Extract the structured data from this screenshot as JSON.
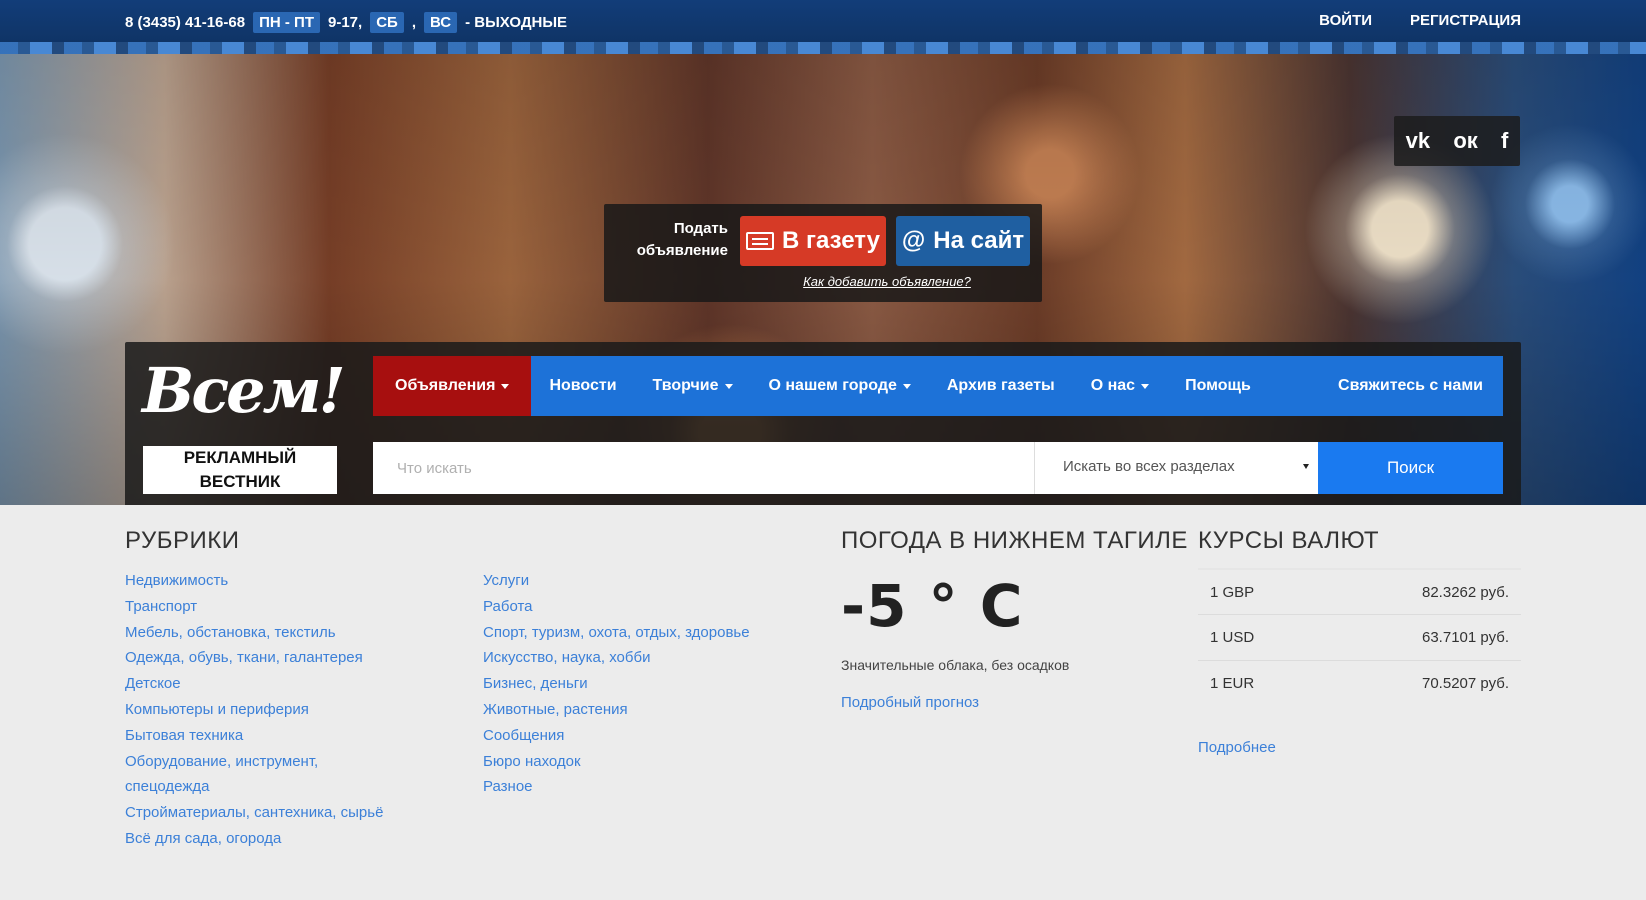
{
  "topbar": {
    "phone": "8 (3435) 41-16-68",
    "days": "ПН - ПТ",
    "hours": "9-17,",
    "sat": "СБ",
    "sun": "ВС",
    "weekend": "- ВЫХОДНЫЕ",
    "login": "ВОЙТИ",
    "register": "РЕГИСТРАЦИЯ"
  },
  "social": {
    "vk": "vk",
    "ok": "ок",
    "fb": "f"
  },
  "post": {
    "label": "Подать объявление",
    "newspaper": "В газету",
    "site": "На сайт",
    "howto": "Как добавить объявление?"
  },
  "logo": {
    "word": "Всем!",
    "tagline": "РЕКЛАМНЫЙ ВЕСТНИК"
  },
  "nav": [
    {
      "label": "Объявления",
      "dropdown": true,
      "active": true
    },
    {
      "label": "Новости",
      "dropdown": false
    },
    {
      "label": "Творчие",
      "dropdown": true
    },
    {
      "label": "О нашем городе",
      "dropdown": true
    },
    {
      "label": "Архив газеты",
      "dropdown": false
    },
    {
      "label": "О нас",
      "dropdown": true
    },
    {
      "label": "Помощь",
      "dropdown": false
    },
    {
      "label": "Свяжитесь с нами",
      "dropdown": false
    }
  ],
  "search": {
    "placeholder": "Что искать",
    "scope": "Искать во всех разделах",
    "button": "Поиск"
  },
  "rubrics": {
    "title": "РУБРИКИ",
    "col1": [
      "Недвижимость",
      "Транспорт",
      "Мебель, обстановка, текстиль",
      "Одежда, обувь, ткани, галантерея",
      "Детское",
      "Компьютеры и периферия",
      "Бытовая техника",
      "Оборудование, инструмент,",
      "спецодежда",
      "Стройматериалы, сантехника, сырьё",
      "Всё для сада, огорода"
    ],
    "col2": [
      "Услуги",
      "Работа",
      "Спорт, туризм, охота, отдых, здоровье",
      "Искусство, наука, хобби",
      "Бизнес, деньги",
      "Животные, растения",
      "Сообщения",
      "Бюро находок",
      "Разное"
    ]
  },
  "weather": {
    "title": "ПОГОДА В НИЖНЕМ ТАГИЛЕ",
    "temp": "-5 ° C",
    "desc": "Значительные облака, без осадков",
    "link": "Подробный прогноз"
  },
  "rates": {
    "title": "КУРСЫ ВАЛЮТ",
    "items": [
      {
        "cur": "1 GBP",
        "value": "82.3262 руб."
      },
      {
        "cur": "1 USD",
        "value": "63.7101 руб."
      },
      {
        "cur": "1 EUR",
        "value": "70.5207 руб."
      }
    ],
    "more": "Подробнее"
  },
  "colors": {
    "nav_blue": "#1d72d8",
    "nav_active": "#a70f0f",
    "link": "#3c80d8",
    "topbar": "#123d79",
    "button_red": "#d63a26",
    "button_blue": "#1f5fa1"
  }
}
